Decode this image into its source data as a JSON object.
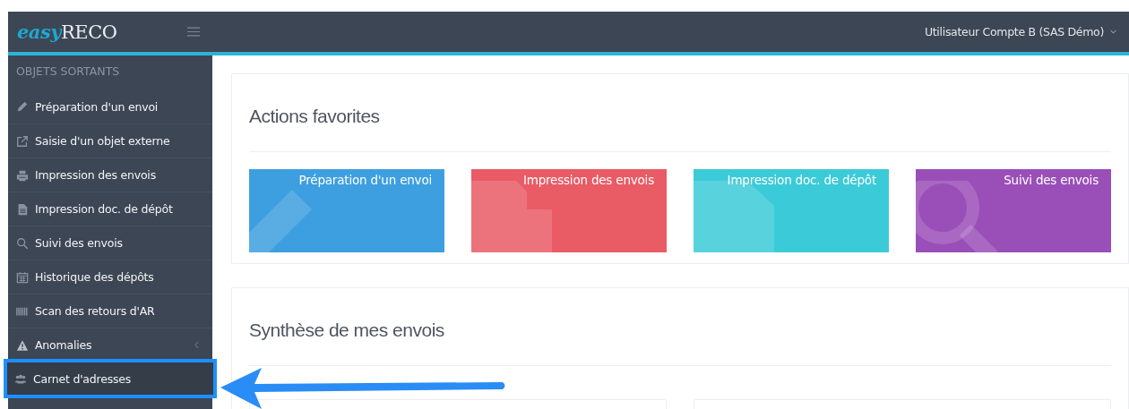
{
  "header": {
    "logo": "**easy**RECO",
    "user_menu": "Utilisateur Compte B (SAS Démo)"
  },
  "sidebar": {
    "section": "OBJETS SORTANTS",
    "items": [
      {
        "label": "Préparation d'un envoi",
        "kind": "pencil",
        "submenu": false,
        "highlighted": false
      },
      {
        "label": "Saisie d'un objet externe",
        "kind": "external",
        "submenu": false,
        "highlighted": false
      },
      {
        "label": "Impression des envois",
        "kind": "printer",
        "submenu": false,
        "highlighted": false
      },
      {
        "label": "Impression doc. de dépôt",
        "kind": "document",
        "submenu": false,
        "highlighted": false
      },
      {
        "label": "Suivi des envois",
        "kind": "search",
        "submenu": false,
        "highlighted": false
      },
      {
        "label": "Historique des dépôts",
        "kind": "calendar",
        "submenu": false,
        "highlighted": false
      },
      {
        "label": "Scan des retours d'AR",
        "kind": "barcode",
        "submenu": false,
        "highlighted": false
      },
      {
        "label": "Anomalies",
        "kind": "warning",
        "submenu": true,
        "highlighted": false
      },
      {
        "label": "Carnet d'adresses",
        "kind": "users",
        "submenu": false,
        "highlighted": true
      }
    ]
  },
  "favorites": {
    "title": "Actions favorites",
    "tiles": [
      {
        "label": "Préparation d'un envoi",
        "kind": "pencil",
        "color": "#3d9fdf"
      },
      {
        "label": "Impression des envois",
        "kind": "printer",
        "color": "#e95b65"
      },
      {
        "label": "Impression doc. de dépôt",
        "kind": "document",
        "color": "#3bcbd8"
      },
      {
        "label": "Suivi des envois",
        "kind": "search",
        "color": "#9a4fb8"
      }
    ]
  },
  "summary": {
    "title": "Synthèse de mes envois"
  },
  "annotation": {
    "kind": "arrow"
  }
}
